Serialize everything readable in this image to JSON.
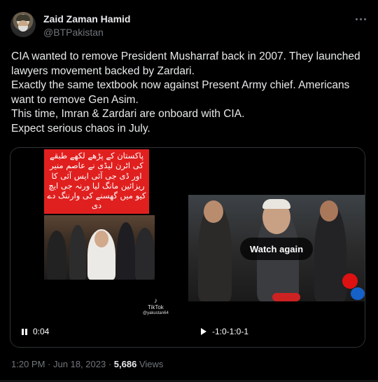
{
  "author": {
    "display_name": "Zaid Zaman Hamid",
    "handle": "@BTPakistan"
  },
  "tweet": {
    "lines": [
      "CIA wanted to remove President Musharraf back in 2007. They launched",
      "lawyers movement backed by Zardari.",
      "Exactly the same textbook now against Present Army chief. Americans",
      "want to remove Gen Asim.",
      "This time, Imran & Zardari are onboard with CIA.",
      "Expect serious chaos in July."
    ]
  },
  "media": {
    "left": {
      "urdu_caption": "پاکستان کے پڑھے لکھے طبقے کی اٹرن لیڈی نے عاصم منیر اور ڈی جی آئی ایس آئی کا ریزائین مانگ لیا ورنہ جی ایچ کیو میں گھسنے کی وارننگ دے دی",
      "watermark": "TikTok",
      "watermark_sub": "@yakustan64",
      "time": "0:04"
    },
    "right": {
      "overlay_label": "Watch again",
      "time": "-1:0-1:0-1"
    }
  },
  "meta": {
    "time": "1:20 PM",
    "date": "Jun 18, 2023",
    "views_count": "5,686",
    "views_label": "Views",
    "separator": "·"
  },
  "icons": {
    "more": "more-horizontal-icon",
    "pause": "pause-icon",
    "play": "play-icon"
  }
}
